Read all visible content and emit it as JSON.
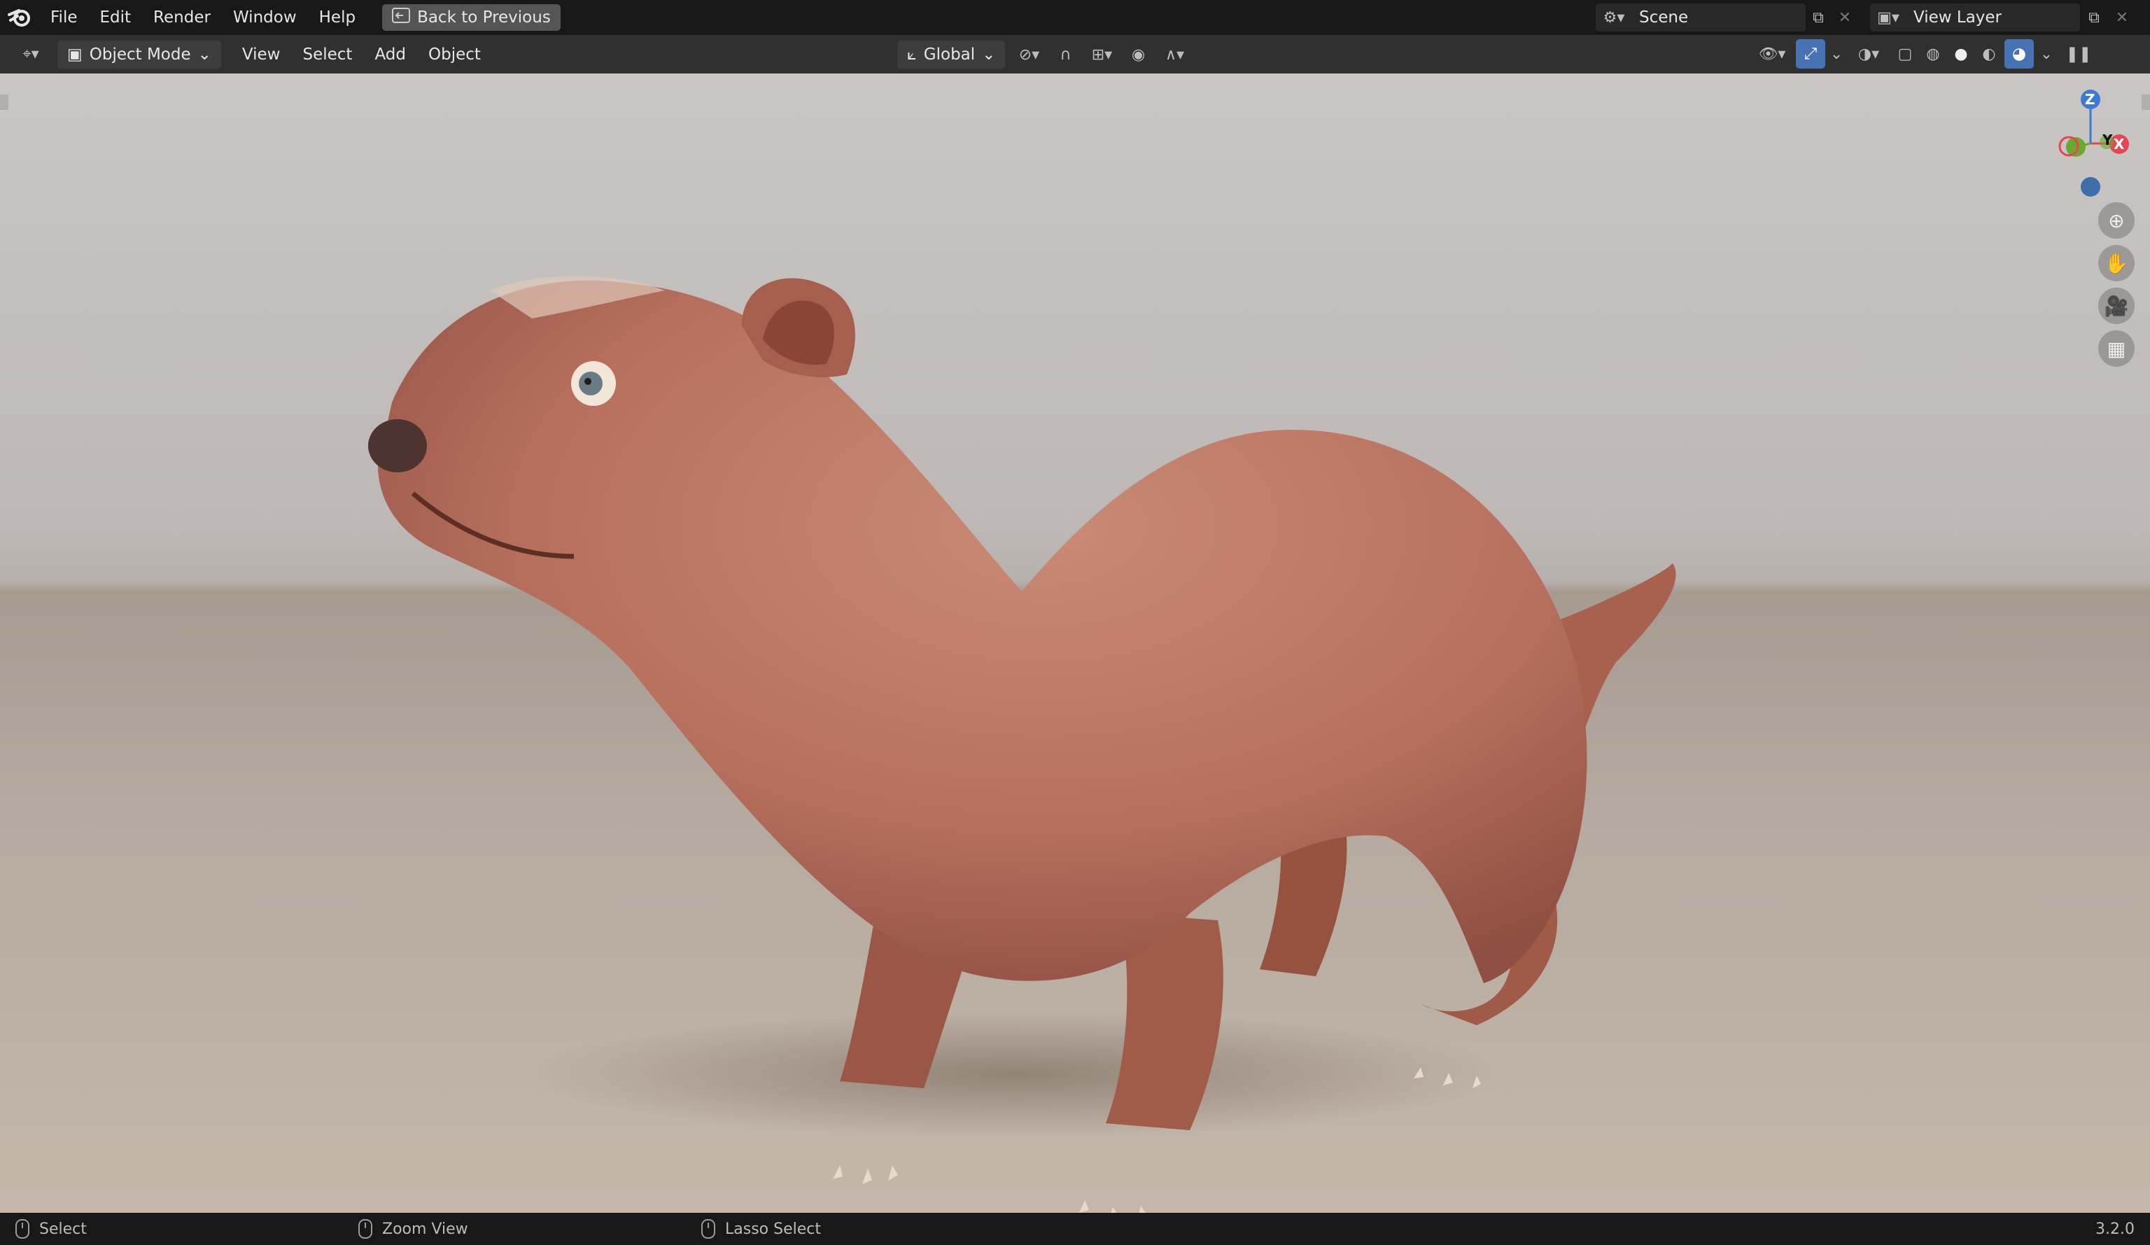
{
  "topbar": {
    "menus": [
      "File",
      "Edit",
      "Render",
      "Window",
      "Help"
    ],
    "back_button": "Back to Previous",
    "scene_label": "Scene",
    "view_layer_label": "View Layer"
  },
  "header": {
    "mode": "Object Mode",
    "menus": [
      "View",
      "Select",
      "Add",
      "Object"
    ],
    "transform_orientation": "Global"
  },
  "gizmo": {
    "z": "Z",
    "y": "Y",
    "x": "X"
  },
  "statusbar": {
    "left": "Select",
    "middle": "Zoom View",
    "right": "Lasso Select",
    "version": "3.2.0"
  },
  "colors": {
    "accent": "#4772b3",
    "axis_x": "#e64553",
    "axis_y": "#6ba82f",
    "axis_z": "#3c7ad6"
  },
  "icons": [
    "blender-logo-icon",
    "back-icon",
    "scene-icon",
    "copy-icon",
    "close-icon",
    "view-layer-icon",
    "editor-type-icon",
    "object-mode-icon",
    "orientation-icon",
    "pivot-icon",
    "snap-icon",
    "proportional-icon",
    "visibility-icon",
    "gizmo-icon",
    "overlay-icon",
    "xray-icon",
    "wireframe-icon",
    "solid-icon",
    "material-icon",
    "rendered-icon",
    "zoom-icon",
    "pan-icon",
    "camera-icon",
    "grid-icon"
  ]
}
